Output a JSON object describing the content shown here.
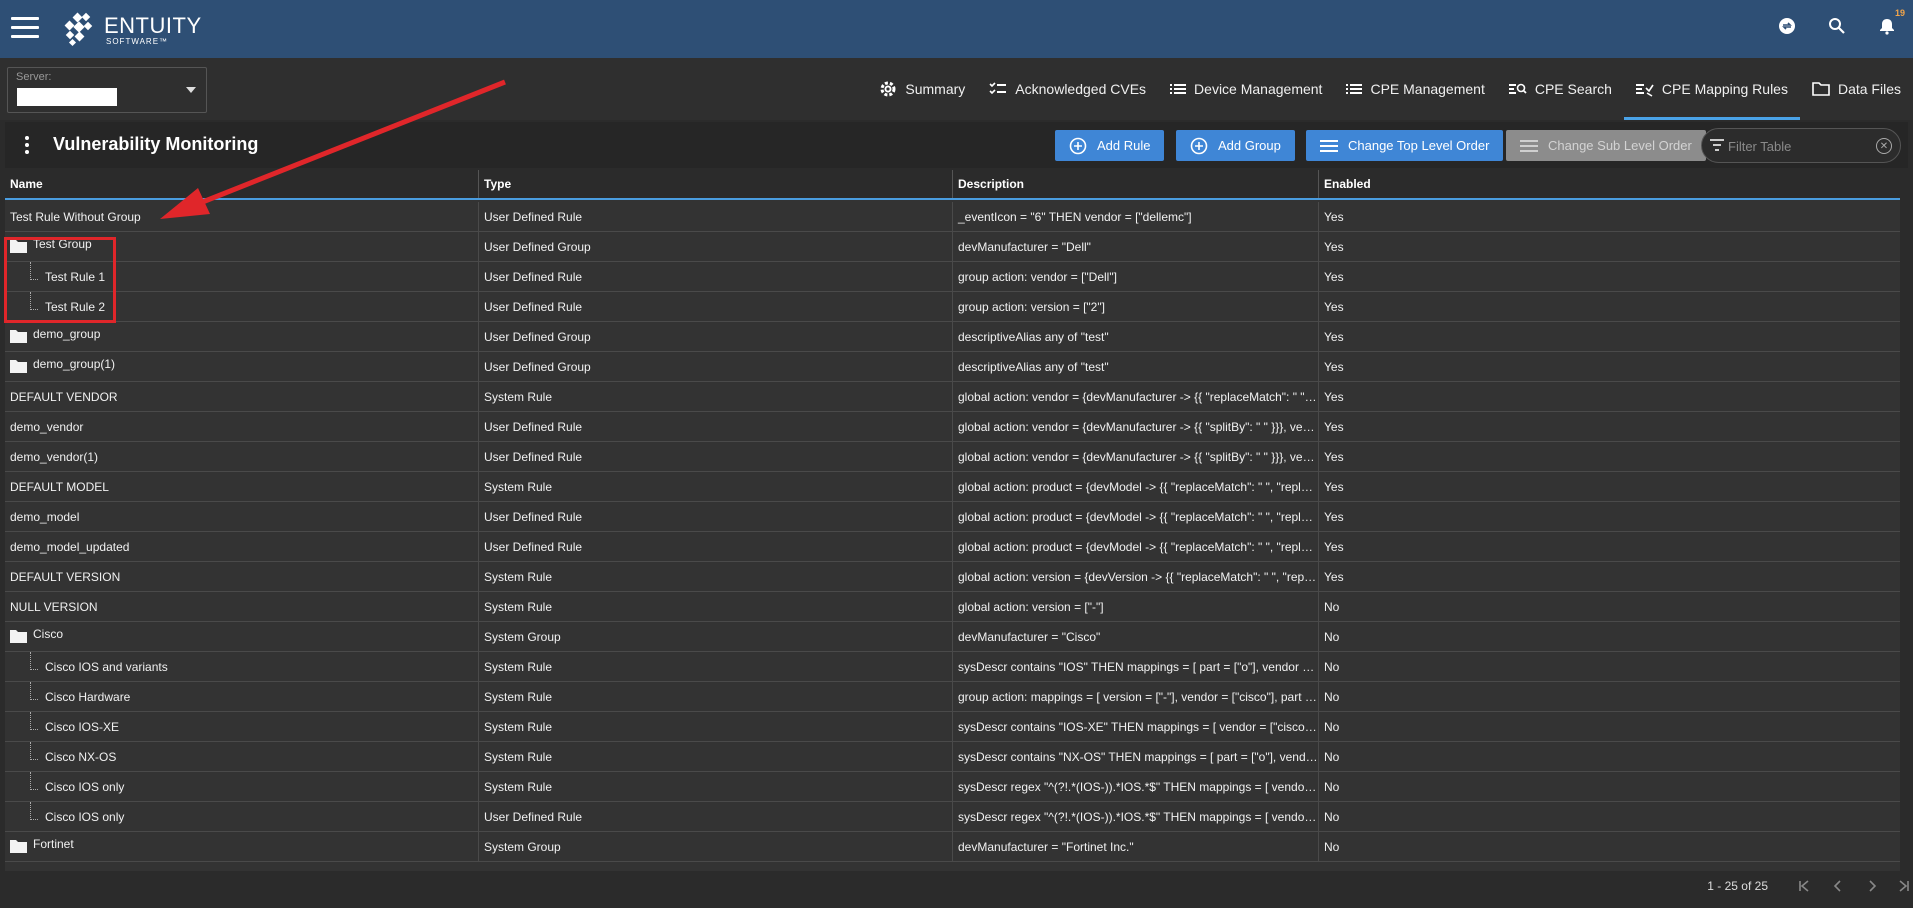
{
  "app": {
    "logo_name": "ENTUITY",
    "logo_sub": "SOFTWARE™",
    "notifications_count": "19"
  },
  "server": {
    "label": "Server:"
  },
  "nav": {
    "tabs": [
      {
        "label": "Summary"
      },
      {
        "label": "Acknowledged CVEs"
      },
      {
        "label": "Device Management"
      },
      {
        "label": "CPE Management"
      },
      {
        "label": "CPE Search"
      },
      {
        "label": "CPE Mapping Rules"
      },
      {
        "label": "Data Files"
      }
    ]
  },
  "page": {
    "title": "Vulnerability Monitoring",
    "buttons": {
      "add_rule": "Add Rule",
      "add_group": "Add Group",
      "change_top": "Change Top Level Order",
      "change_sub": "Change Sub Level Order"
    },
    "filter_placeholder": "Filter Table"
  },
  "table": {
    "headers": [
      "Name",
      "Type",
      "Description",
      "Enabled"
    ],
    "rows": [
      {
        "name": "Test Rule Without Group",
        "type": "User Defined Rule",
        "description": "_eventIcon = \"6\" THEN vendor = [\"dellemc\"]",
        "enabled": "Yes"
      },
      {
        "name": "Test Group",
        "type": "User Defined Group",
        "description": "devManufacturer = \"Dell\"",
        "enabled": "Yes"
      },
      {
        "name": "Test Rule 1",
        "type": "User Defined Rule",
        "description": "group action: vendor = [\"Dell\"]",
        "enabled": "Yes"
      },
      {
        "name": "Test Rule 2",
        "type": "User Defined Rule",
        "description": "group action: version = [\"2\"]",
        "enabled": "Yes"
      },
      {
        "name": "demo_group",
        "type": "User Defined Group",
        "description": "descriptiveAlias any of \"test\"",
        "enabled": "Yes"
      },
      {
        "name": "demo_group(1)",
        "type": "User Defined Group",
        "description": "descriptiveAlias any of \"test\"",
        "enabled": "Yes"
      },
      {
        "name": "DEFAULT VENDOR",
        "type": "System Rule",
        "description": "global action: vendor = {devManufacturer -> {{ \"replaceMatch\": \" \", \"replaceWith\": \"_\" }}}",
        "enabled": "Yes"
      },
      {
        "name": "demo_vendor",
        "type": "User Defined Rule",
        "description": "global action: vendor = {devManufacturer -> {{ \"splitBy\": \" \" }}}, vendor",
        "enabled": "Yes"
      },
      {
        "name": "demo_vendor(1)",
        "type": "User Defined Rule",
        "description": "global action: vendor = {devManufacturer -> {{ \"splitBy\": \" \" }}}, vendor",
        "enabled": "Yes"
      },
      {
        "name": "DEFAULT MODEL",
        "type": "System Rule",
        "description": "global action: product = {devModel -> {{ \"replaceMatch\": \" \", \"replaceWith\": \"_\" }}}",
        "enabled": "Yes"
      },
      {
        "name": "demo_model",
        "type": "User Defined Rule",
        "description": "global action: product = {devModel -> {{ \"replaceMatch\": \" \", \"replaceWith\": \"_\" }}}",
        "enabled": "Yes"
      },
      {
        "name": "demo_model_updated",
        "type": "User Defined Rule",
        "description": "global action: product = {devModel -> {{ \"replaceMatch\": \" \", \"replaceWith\": \"_\" }}}",
        "enabled": "Yes"
      },
      {
        "name": "DEFAULT VERSION",
        "type": "System Rule",
        "description": "global action: version = {devVersion -> {{ \"replaceMatch\": \" \", \"replaceWith\": \"_\" }}}",
        "enabled": "Yes"
      },
      {
        "name": "NULL VERSION",
        "type": "System Rule",
        "description": "global action: version = [\"-\"]",
        "enabled": "No"
      },
      {
        "name": "Cisco",
        "type": "System Group",
        "description": "devManufacturer = \"Cisco\"",
        "enabled": "No"
      },
      {
        "name": "Cisco IOS and variants",
        "type": "System Rule",
        "description": "sysDescr contains \"IOS\" THEN mappings = [ part = [\"o\"], vendor = [\"cisco\"] ]",
        "enabled": "No"
      },
      {
        "name": "Cisco Hardware",
        "type": "System Rule",
        "description": "group action: mappings = [ version = [\"-\"], vendor = [\"cisco\"], part = [\"h\"] ]",
        "enabled": "No"
      },
      {
        "name": "Cisco IOS-XE",
        "type": "System Rule",
        "description": "sysDescr contains \"IOS-XE\" THEN mappings = [ vendor = [\"cisco\"], part = [\"o\"] ]",
        "enabled": "No"
      },
      {
        "name": "Cisco NX-OS",
        "type": "System Rule",
        "description": "sysDescr contains \"NX-OS\" THEN mappings = [ part = [\"o\"], vendor = [\"cisco\"] ]",
        "enabled": "No"
      },
      {
        "name": "Cisco IOS only",
        "type": "System Rule",
        "description": "sysDescr regex \"^(?!.*(IOS-)).*IOS.*$\" THEN mappings = [ vendor = [\"cisco\"] ]",
        "enabled": "No"
      },
      {
        "name": "Cisco IOS only",
        "type": "User Defined Rule",
        "description": "sysDescr regex \"^(?!.*(IOS-)).*IOS.*$\" THEN mappings = [ vendor = [\"cisco\"] ]",
        "enabled": "No"
      },
      {
        "name": "Fortinet",
        "type": "System Group",
        "description": "devManufacturer = \"Fortinet Inc.\"",
        "enabled": "No"
      }
    ]
  },
  "pager": {
    "info": "1 - 25 of 25"
  },
  "colors": {
    "topbar": "#2e4f75",
    "accent": "#3f86d6",
    "annotation": "#e0262a"
  }
}
